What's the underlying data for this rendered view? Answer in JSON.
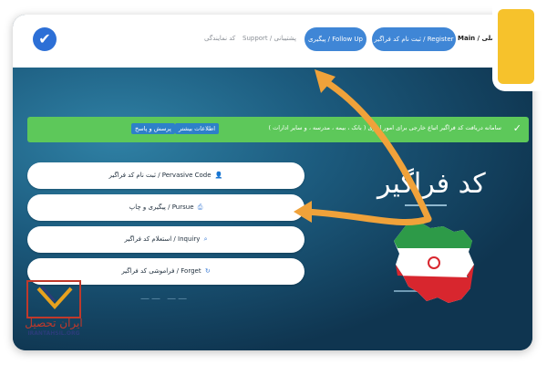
{
  "header": {
    "nav_main": "Main / اصلی",
    "register_label": "ثبت نام کد فراگیر / Register",
    "follow_label": "پیگیری / Follow Up",
    "support_label": "پشتیبانی / Support",
    "agency_label": "کد نمایندگی"
  },
  "alert": {
    "message": "سامانه دریافت کد فراگیر اتباع خارجی برای امور اداری ( بانک ، بیمه ، مدرسه ، و سایر ادارات )",
    "more_label": "اطلاعات بیشتر",
    "faq_label": "پرسش و پاسخ"
  },
  "menu": {
    "items": [
      {
        "label": "ثبت نام کد فراگیر / Pervasive Code"
      },
      {
        "label": "پیگیری و چاپ / Pursue"
      },
      {
        "label": "استعلام کد فراگیر / Inquiry"
      },
      {
        "label": "فراموشی کد فراگیر / Forget"
      }
    ]
  },
  "hero": {
    "title": "کد فراگیر"
  },
  "logo": {
    "name": "ایران تحصیل",
    "url_text": "IRANTAHSIL.ORG"
  },
  "colors": {
    "accent_blue": "#3f86d6",
    "alert_green": "#5dc85a",
    "arrow_orange": "#f0a23a",
    "brand_yellow": "#f6c22c"
  }
}
